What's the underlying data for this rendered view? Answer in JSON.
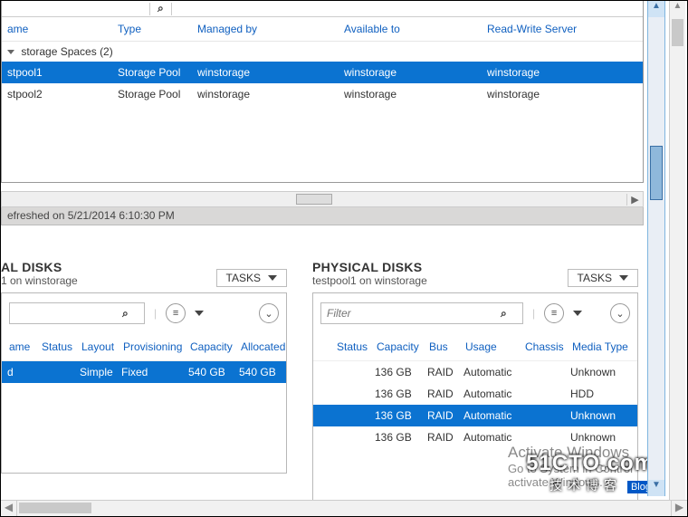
{
  "top": {
    "search_placeholder": "",
    "columns": {
      "name": "ame",
      "type": "Type",
      "managed": "Managed by",
      "available": "Available to",
      "rw": "Read-Write Server"
    },
    "group_label": "storage Spaces (2)",
    "rows": [
      {
        "name": "stpool1",
        "type": "Storage Pool",
        "managed": "winstorage",
        "available": "winstorage",
        "rw": "winstorage",
        "selected": true
      },
      {
        "name": "stpool2",
        "type": "Storage Pool",
        "managed": "winstorage",
        "available": "winstorage",
        "rw": "winstorage",
        "selected": false
      }
    ],
    "refresh_status": "efreshed on 5/21/2014 6:10:30 PM"
  },
  "virtual": {
    "title": "AL DISKS",
    "subtitle": "1 on winstorage",
    "tasks_label": "TASKS",
    "filter_placeholder": "",
    "columns": {
      "name": "ame",
      "status": "Status",
      "layout": "Layout",
      "prov": "Provisioning",
      "capacity": "Capacity",
      "alloc": "Allocated"
    },
    "rows": [
      {
        "name": "d",
        "status": "",
        "layout": "Simple",
        "prov": "Fixed",
        "capacity": "540 GB",
        "alloc": "540 GB",
        "selected": true
      }
    ]
  },
  "physical": {
    "title": "PHYSICAL DISKS",
    "subtitle": "testpool1 on winstorage",
    "tasks_label": "TASKS",
    "filter_placeholder": "Filter",
    "columns": {
      "slot": "",
      "status": "Status",
      "capacity": "Capacity",
      "bus": "Bus",
      "usage": "Usage",
      "chassis": "Chassis",
      "media": "Media Type"
    },
    "rows": [
      {
        "capacity": "136 GB",
        "bus": "RAID",
        "usage": "Automatic",
        "chassis": "",
        "media": "Unknown",
        "selected": false
      },
      {
        "capacity": "136 GB",
        "bus": "RAID",
        "usage": "Automatic",
        "chassis": "",
        "media": "HDD",
        "selected": false
      },
      {
        "capacity": "136 GB",
        "bus": "RAID",
        "usage": "Automatic",
        "chassis": "",
        "media": "Unknown",
        "selected": true
      },
      {
        "capacity": "136 GB",
        "bus": "RAID",
        "usage": "Automatic",
        "chassis": "",
        "media": "Unknown",
        "selected": false
      }
    ]
  },
  "watermark": {
    "l1": "Activate Windows",
    "l2": "Go to System in Control",
    "l3": "activate Windows."
  },
  "logo": {
    "brand": "51CTO.com",
    "sub": "技术博客",
    "tag": "Blog"
  }
}
